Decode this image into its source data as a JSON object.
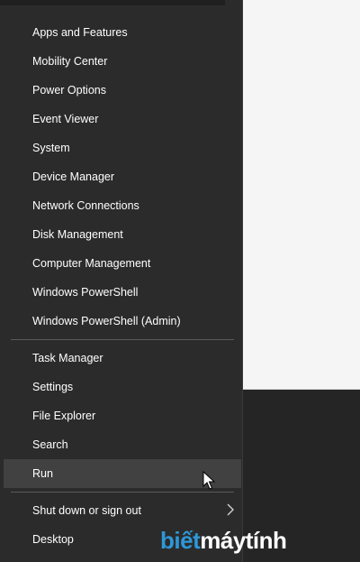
{
  "menu": {
    "group1": [
      {
        "label": "Apps and Features"
      },
      {
        "label": "Mobility Center"
      },
      {
        "label": "Power Options"
      },
      {
        "label": "Event Viewer"
      },
      {
        "label": "System"
      },
      {
        "label": "Device Manager"
      },
      {
        "label": "Network Connections"
      },
      {
        "label": "Disk Management"
      },
      {
        "label": "Computer Management"
      },
      {
        "label": "Windows PowerShell"
      },
      {
        "label": "Windows PowerShell (Admin)"
      }
    ],
    "group2": [
      {
        "label": "Task Manager"
      },
      {
        "label": "Settings"
      },
      {
        "label": "File Explorer"
      },
      {
        "label": "Search"
      },
      {
        "label": "Run"
      }
    ],
    "group3": [
      {
        "label": "Shut down or sign out"
      },
      {
        "label": "Desktop"
      }
    ]
  },
  "watermark": {
    "part1": "biết",
    "part2": "máytính"
  },
  "colors": {
    "menu_bg": "#2b2b2b",
    "hover": "#414141",
    "text": "#ffffff",
    "watermark_blue": "#2e97d8"
  },
  "icons": {
    "submenu": "chevron-right-icon",
    "pointer": "mouse-cursor-icon"
  }
}
